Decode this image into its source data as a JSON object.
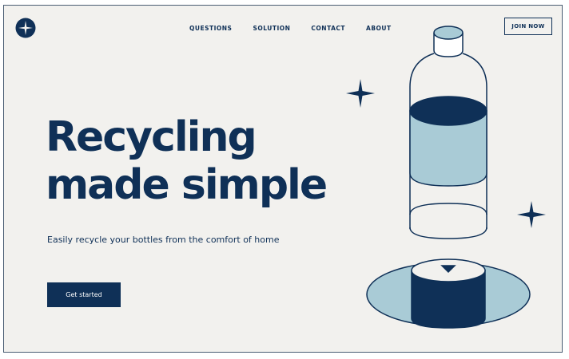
{
  "nav": {
    "items": [
      {
        "label": "QUESTIONS"
      },
      {
        "label": "SOLUTION"
      },
      {
        "label": "CONTACT"
      },
      {
        "label": "ABOUT"
      }
    ],
    "join_label": "JOIN NOW"
  },
  "hero": {
    "headline_line1": "Recycling",
    "headline_line2": "made simple",
    "subtitle": "Easily recycle your bottles from the comfort of home",
    "cta_label": "Get started"
  },
  "colors": {
    "brand": "#0f3057",
    "accent_light": "#a9cbd6",
    "background": "#f2f1ee"
  },
  "icons": {
    "logo": "sparkle-circle-logo",
    "stars": "sparkle-icon"
  }
}
